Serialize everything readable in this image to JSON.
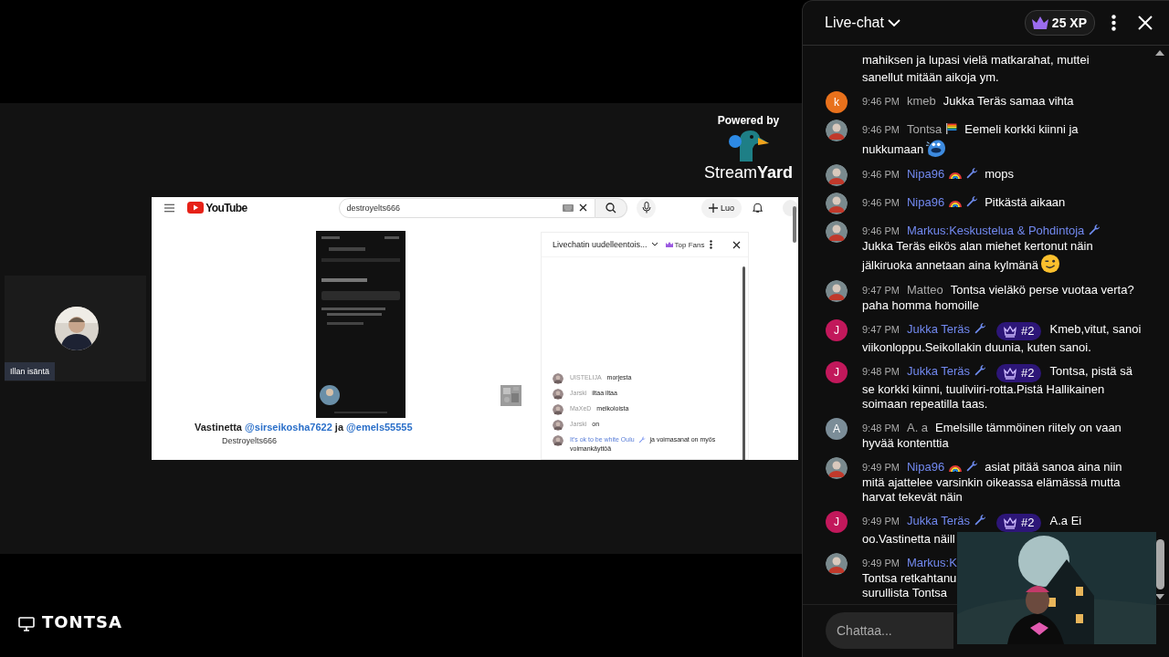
{
  "stage": {
    "branding": {
      "caption": "Powered by",
      "name": "Stream**Yard**"
    },
    "host": {
      "label": "Illan isäntä"
    },
    "screen": {
      "logo": "YouTube",
      "search": {
        "value": "destroyelts666"
      },
      "create_button": "Luo",
      "caption": [
        {
          "kind": "text",
          "text": "Vastinetta"
        },
        {
          "kind": "link",
          "text": "@sirseikosha7622"
        },
        {
          "kind": "text",
          "text": "ja"
        },
        {
          "kind": "link",
          "text": "@emels55555"
        }
      ],
      "channel": "Destroyelts666",
      "chat": {
        "title": "Livechatin uudelleentois...",
        "filter": "Top Fans",
        "messages": [
          {
            "author": "UISTELIJA",
            "text": "morjesta",
            "moderator": false
          },
          {
            "author": "Jarski",
            "text": "iltaa iltaa",
            "moderator": false
          },
          {
            "author": "MaXeD",
            "text": "melkoloista",
            "moderator": false
          },
          {
            "author": "Jarski",
            "text": "on",
            "moderator": false
          },
          {
            "author": "It's ok to be white Oulu",
            "text": "ja voimasanat on myös voimankäyttöä",
            "moderator": true,
            "badges": [
              {
                "kind": "wrench"
              }
            ]
          }
        ]
      }
    }
  },
  "footer": {
    "name": "TONTSA"
  },
  "chat": {
    "title": "Live-chat",
    "xp": "25 XP",
    "messages": [
      {
        "kind": "continuation",
        "lines": [
          "mahiksen ja lupasi vielä matkarahat, muttei",
          "sanellut mitään aikoja ym."
        ]
      },
      {
        "kind": "message",
        "avatar": {
          "kind": "letter",
          "letter": "k",
          "color": "#e8711c"
        },
        "time": "9:46 PM",
        "author": "kmeb",
        "moderator": false,
        "text": "Jukka Teräs samaa vihta"
      },
      {
        "kind": "message",
        "avatar": {
          "kind": "picture"
        },
        "time": "9:46 PM",
        "author": "Tontsa",
        "moderator": false,
        "badges": [
          {
            "kind": "flag"
          }
        ],
        "text": "Eemeli korkki kiinni ja",
        "lines": [
          "nukkumaan"
        ],
        "emoji": {
          "kind": "blob"
        }
      },
      {
        "kind": "message",
        "avatar": {
          "kind": "picture"
        },
        "time": "9:46 PM",
        "author": "Nipa96",
        "moderator": true,
        "badges": [
          {
            "kind": "rainbow"
          },
          {
            "kind": "wrench"
          }
        ],
        "text": "mops"
      },
      {
        "kind": "message",
        "avatar": {
          "kind": "picture"
        },
        "time": "9:46 PM",
        "author": "Nipa96",
        "moderator": true,
        "badges": [
          {
            "kind": "rainbow"
          },
          {
            "kind": "wrench"
          }
        ],
        "text": "Pitkästä aikaan"
      },
      {
        "kind": "message",
        "avatar": {
          "kind": "picture"
        },
        "time": "9:46 PM",
        "author": "Markus:Keskustelua & Pohdintoja",
        "moderator": true,
        "badges": [
          {
            "kind": "wrench"
          }
        ],
        "lines": [
          "Jukka Teräs eikös alan miehet kertonut näin",
          "jälkiruoka annetaan aina kylmänä"
        ],
        "emoji": {
          "kind": "wink"
        }
      },
      {
        "kind": "message",
        "avatar": {
          "kind": "picture"
        },
        "time": "9:47 PM",
        "author": "Matteo",
        "moderator": false,
        "text": "Tontsa vieläkö perse vuotaa verta?",
        "lines": [
          "paha homma homoille"
        ]
      },
      {
        "kind": "message",
        "avatar": {
          "kind": "letter",
          "letter": "J",
          "color": "#c2185b"
        },
        "time": "9:47 PM",
        "author": "Jukka Teräs",
        "moderator": true,
        "badges": [
          {
            "kind": "wrench"
          }
        ],
        "rank": "#2",
        "text": "Kmeb,vitut, sanoi",
        "lines": [
          "viikonloppu.Seikollakin duunia, kuten sanoi."
        ]
      },
      {
        "kind": "message",
        "avatar": {
          "kind": "letter",
          "letter": "J",
          "color": "#c2185b"
        },
        "time": "9:48 PM",
        "author": "Jukka Teräs",
        "moderator": true,
        "badges": [
          {
            "kind": "wrench"
          }
        ],
        "rank": "#2",
        "text": "Tontsa, pistä sä",
        "lines": [
          "se korkki kiinni, tuuliviiri-rotta.Pistä Hallikainen",
          "soimaan repeatilla taas."
        ]
      },
      {
        "kind": "message",
        "avatar": {
          "kind": "letter",
          "letter": "A",
          "color": "#7b8d98"
        },
        "time": "9:48 PM",
        "author": "A. a",
        "moderator": false,
        "text": "Emelsille tämmöinen riitely on vaan",
        "lines": [
          "hyvää kontenttia"
        ]
      },
      {
        "kind": "message",
        "avatar": {
          "kind": "picture"
        },
        "time": "9:49 PM",
        "author": "Nipa96",
        "moderator": true,
        "badges": [
          {
            "kind": "rainbow"
          },
          {
            "kind": "wrench"
          }
        ],
        "text": "asiat pitää sanoa aina niin",
        "lines": [
          "mitä ajattelee varsinkin oikeassa elämässä mutta",
          "harvat tekevät näin"
        ]
      },
      {
        "kind": "message",
        "avatar": {
          "kind": "letter",
          "letter": "J",
          "color": "#c2185b"
        },
        "time": "9:49 PM",
        "author": "Jukka Teräs",
        "moderator": true,
        "badges": [
          {
            "kind": "wrench"
          }
        ],
        "rank": "#2",
        "text": "A.a Ei",
        "lines": [
          "oo.Vastinetta näill"
        ]
      },
      {
        "kind": "message",
        "avatar": {
          "kind": "picture"
        },
        "time": "9:49 PM",
        "author": "Markus:K",
        "moderator": true,
        "lines": [
          "Tontsa retkahtanu",
          "surullista Tontsa"
        ]
      }
    ],
    "input": {
      "placeholder": "Chattaa..."
    }
  }
}
